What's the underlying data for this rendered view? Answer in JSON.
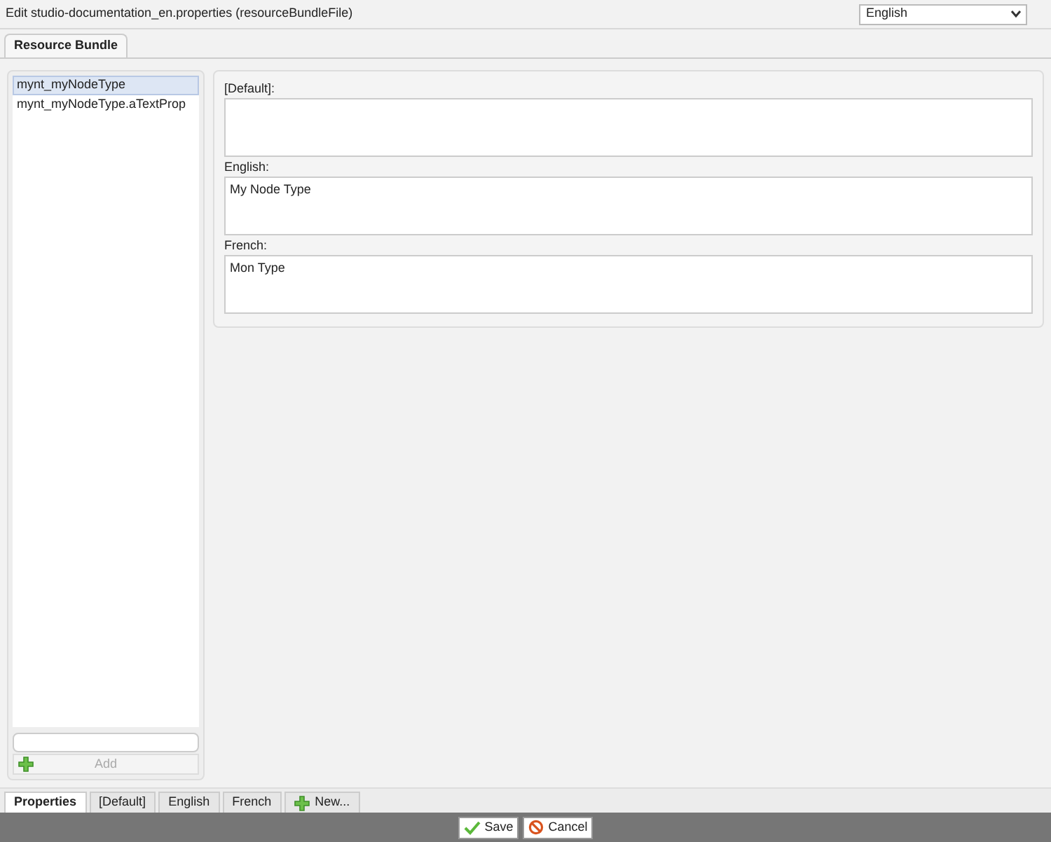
{
  "window": {
    "title": "Edit studio-documentation_en.properties (resourceBundleFile)"
  },
  "language_select": {
    "value": "English"
  },
  "top_tabs": [
    {
      "label": "Resource Bundle",
      "selected": true
    }
  ],
  "keys": [
    {
      "label": "mynt_myNodeType",
      "selected": true
    },
    {
      "label": "mynt_myNodeType.aTextProp",
      "selected": false
    }
  ],
  "add_button": {
    "label": "Add",
    "disabled": true
  },
  "translations": [
    {
      "label": "[Default]:"
    },
    {
      "label": "English:",
      "value": "My Node Type"
    },
    {
      "label": "French:",
      "value": "Mon Type"
    }
  ],
  "bottom_tabs": [
    {
      "label": "Properties",
      "selected": true,
      "kind": "tab"
    },
    {
      "label": "[Default]",
      "selected": false,
      "kind": "tab"
    },
    {
      "label": "English",
      "selected": false,
      "kind": "tab"
    },
    {
      "label": "French",
      "selected": false,
      "kind": "tab"
    },
    {
      "label": "New...",
      "selected": false,
      "kind": "new"
    }
  ],
  "buttons": [
    {
      "label": "Save",
      "kind": "save"
    },
    {
      "label": "Cancel",
      "kind": "cancel"
    }
  ]
}
